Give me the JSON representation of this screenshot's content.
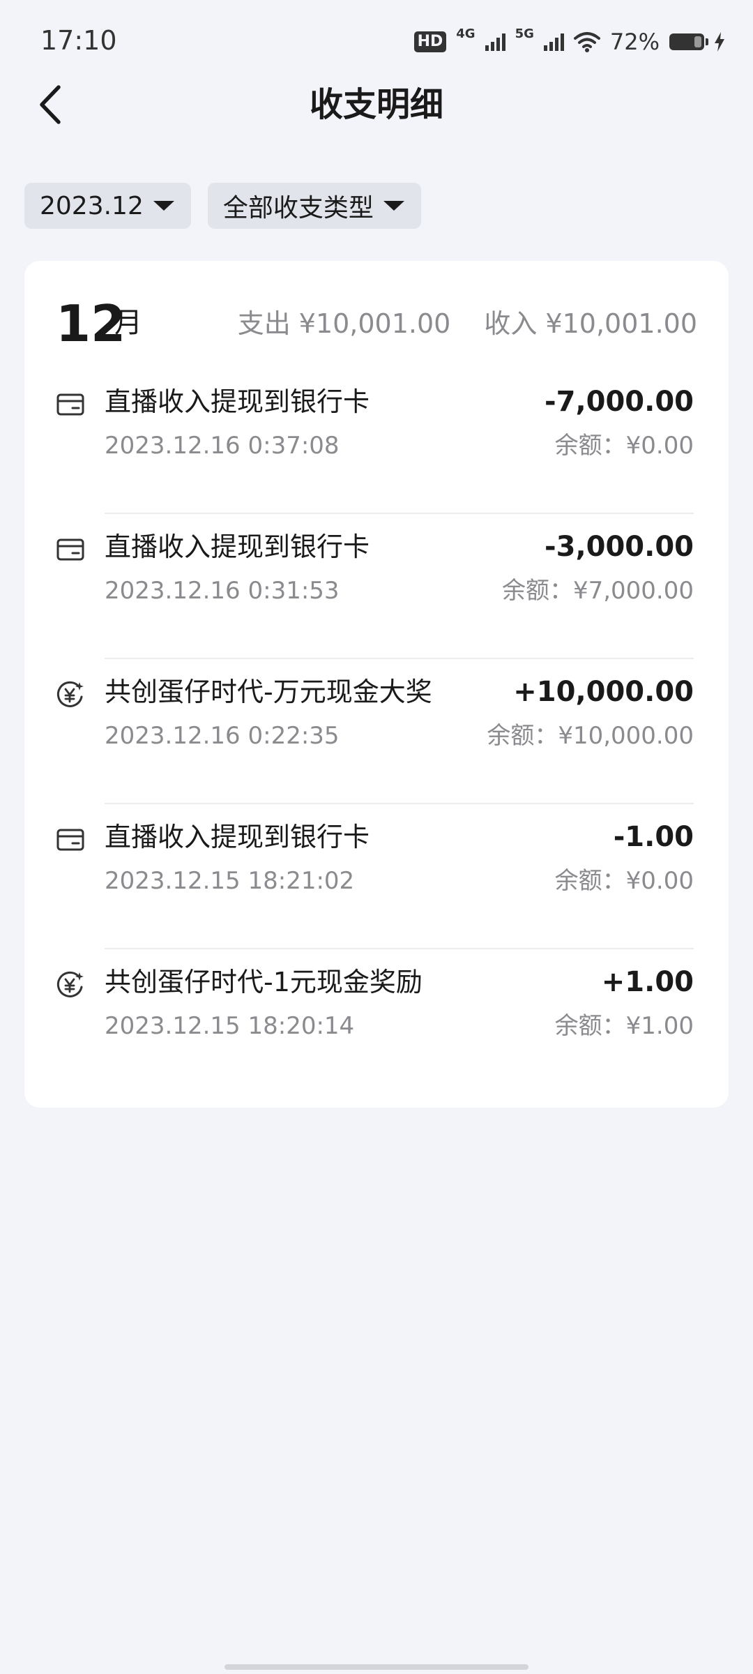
{
  "status_bar": {
    "time": "17:10",
    "hd": "HD",
    "net1": "4G",
    "net2": "5G",
    "battery": "72%"
  },
  "header": {
    "title": "收支明细",
    "back_icon": "chevron-left-icon"
  },
  "filters": {
    "month": "2023.12",
    "type": "全部收支类型"
  },
  "summary": {
    "month_num": "12",
    "month_unit": "月",
    "expense": "支出 ¥10,001.00",
    "income": "收入 ¥10,001.00"
  },
  "transactions": [
    {
      "icon": "bank-card-icon",
      "title": "直播收入提现到银行卡",
      "time": "2023.12.16 0:37:08",
      "amount": "-7,000.00",
      "balance": "余额：¥0.00"
    },
    {
      "icon": "bank-card-icon",
      "title": "直播收入提现到银行卡",
      "time": "2023.12.16 0:31:53",
      "amount": "-3,000.00",
      "balance": "余额：¥7,000.00"
    },
    {
      "icon": "yuan-coin-icon",
      "title": "共创蛋仔时代-万元现金大奖",
      "time": "2023.12.16 0:22:35",
      "amount": "+10,000.00",
      "balance": "余额：¥10,000.00"
    },
    {
      "icon": "bank-card-icon",
      "title": "直播收入提现到银行卡",
      "time": "2023.12.15 18:21:02",
      "amount": "-1.00",
      "balance": "余额：¥0.00"
    },
    {
      "icon": "yuan-coin-icon",
      "title": "共创蛋仔时代-1元现金奖励",
      "time": "2023.12.15 18:20:14",
      "amount": "+1.00",
      "balance": "余额：¥1.00"
    }
  ]
}
